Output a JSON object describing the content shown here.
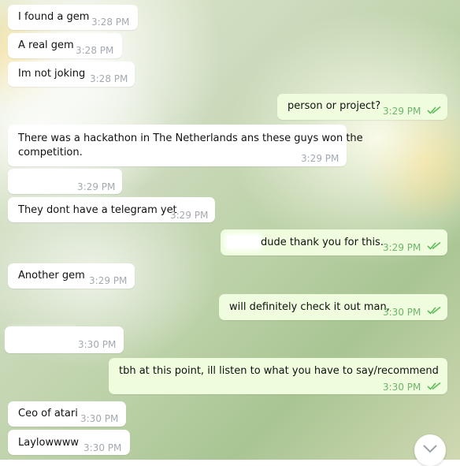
{
  "messages": [
    {
      "text": "I found a gem",
      "time": "3:28 PM"
    },
    {
      "text": "A real gem",
      "time": "3:28 PM"
    },
    {
      "text": "Im not joking",
      "time": "3:28 PM"
    },
    {
      "text": "person or project?",
      "time": "3:29 PM"
    },
    {
      "line1": "There was a hackathon in The Netherlands ans these guys won the",
      "line2": "competition.",
      "time": "3:29 PM"
    },
    {
      "text": "",
      "time": "3:29 PM"
    },
    {
      "text": "They dont have a telegram yet",
      "time": "3:29 PM"
    },
    {
      "text": "dude thank you for this.",
      "time": "3:29 PM"
    },
    {
      "text": "Another gem",
      "time": "3:29 PM"
    },
    {
      "text": "will definitely check it out man,",
      "time": "3:30 PM"
    },
    {
      "text": "",
      "time": "3:30 PM"
    },
    {
      "text": "tbh at this point, ill listen to what you have to say/recommend",
      "time": "3:30 PM"
    },
    {
      "text": "Ceo of atari",
      "time": "3:30 PM"
    },
    {
      "text": "Laylowwww",
      "time": "3:30 PM"
    }
  ],
  "colors": {
    "incoming_bubble": "#ffffff",
    "outgoing_bubble": "#effdde",
    "read_check": "#5dbb5a"
  },
  "icons": {
    "read_receipt": "double-check-icon",
    "scroll_down": "chevron-down-icon"
  }
}
